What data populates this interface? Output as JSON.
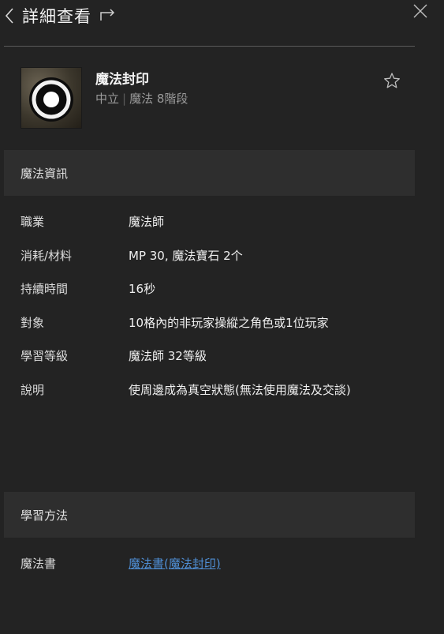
{
  "header": {
    "title": "詳細查看"
  },
  "skill": {
    "name": "魔法封印",
    "alignment": "中立",
    "category": "魔法 8階段"
  },
  "sections": {
    "info_title": "魔法資訊",
    "learn_title": "學習方法"
  },
  "info": [
    {
      "label": "職業",
      "value": "魔法師"
    },
    {
      "label": "消耗/材料",
      "value": "MP 30, 魔法寶石 2个"
    },
    {
      "label": "持續時間",
      "value": "16秒"
    },
    {
      "label": "對象",
      "value": "10格內的非玩家操縱之角色或1位玩家"
    },
    {
      "label": "學習等級",
      "value": "魔法師 32等級"
    },
    {
      "label": "說明",
      "value": "使周邊成為真空狀態(無法使用魔法及交談)"
    }
  ],
  "learn": [
    {
      "label": "魔法書",
      "value": "魔法書(魔法封印)"
    }
  ]
}
